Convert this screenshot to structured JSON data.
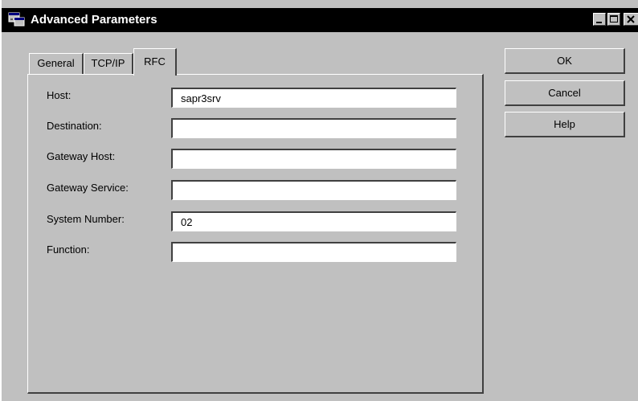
{
  "window": {
    "title": "Advanced Parameters",
    "icon": "app-window-icon"
  },
  "tabs": [
    {
      "label": "General",
      "active": false
    },
    {
      "label": "TCP/IP",
      "active": false
    },
    {
      "label": "RFC",
      "active": true
    }
  ],
  "fields": [
    {
      "label": "Host:",
      "value": "sapr3srv"
    },
    {
      "label": "Destination:",
      "value": ""
    },
    {
      "label": "Gateway Host:",
      "value": ""
    },
    {
      "label": "Gateway Service:",
      "value": ""
    },
    {
      "label": "System Number:",
      "value": "02"
    },
    {
      "label": "Function:",
      "value": ""
    }
  ],
  "buttons": {
    "ok": "OK",
    "cancel": "Cancel",
    "help": "Help"
  },
  "colors": {
    "face": "#c0c0c0",
    "titlebar": "#000000",
    "highlight": "#ffffff",
    "shadow": "#404040"
  }
}
